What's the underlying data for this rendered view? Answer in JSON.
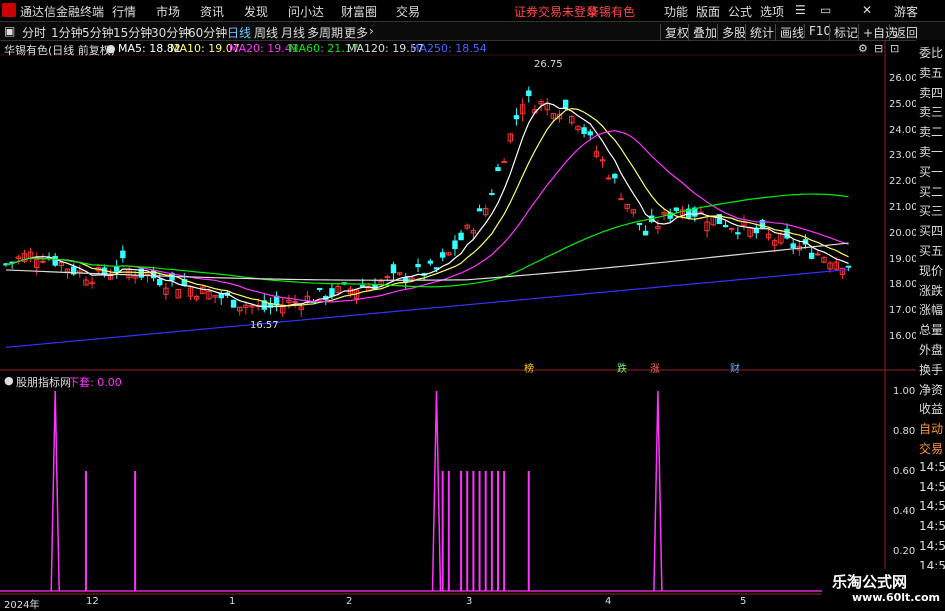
{
  "menubar": {
    "app_title": "通达信金融终端",
    "items": [
      "行情",
      "市场",
      "资讯",
      "发现",
      "问小达",
      "财富圈",
      "交易"
    ],
    "notice": "证券交易未登录",
    "stock_name": "华锡有色",
    "right_items": [
      "功能",
      "版面",
      "公式",
      "选项"
    ],
    "guest": "游客"
  },
  "toolbar": {
    "periods": [
      "分时",
      "1分钟",
      "5分钟",
      "15分钟",
      "30分钟",
      "60分钟",
      "日线",
      "周线",
      "月线",
      "多周期",
      "更多"
    ],
    "active_period": "日线",
    "right_buttons": [
      "复权",
      "叠加",
      "多股",
      "统计",
      "画线",
      "F10",
      "标记",
      "+自选",
      "返回"
    ]
  },
  "legend": {
    "stock": "华锡有色(日线 前复权)",
    "ma5": "MA5: 18.82",
    "ma10": "MA10: 19.07",
    "ma20": "MA20: 19.41",
    "ma60": "MA60: 21.17",
    "ma120": "MA120: 19.57",
    "ma250": "MA250: 18.54"
  },
  "colors": {
    "ma5": "#ffffff",
    "ma10": "#ffff66",
    "ma20": "#ff33ff",
    "ma60": "#00ee00",
    "ma120": "#dddddd",
    "ma250": "#3333ff",
    "up": "#ff3333",
    "down": "#33ffff",
    "indicator": "#ff33ff"
  },
  "price_axis": [
    "26.00",
    "25.00",
    "24.00",
    "23.00",
    "22.00",
    "21.00",
    "20.00",
    "19.00",
    "18.00",
    "17.00",
    "16.00"
  ],
  "annotations": {
    "high": "26.75",
    "low": "16.57",
    "markers": [
      {
        "label": "榜",
        "color": "#ffcc00"
      },
      {
        "label": "跌",
        "color": "#66ff66"
      },
      {
        "label": "涨",
        "color": "#ff6666"
      },
      {
        "label": "财",
        "color": "#66aaff"
      }
    ]
  },
  "indicator": {
    "name": "股朋指标网",
    "label": "下套: 0.00",
    "y_axis": [
      "1.00",
      "0.80",
      "0.60",
      "0.40",
      "0.20"
    ]
  },
  "right_panel": [
    "委比",
    "卖五",
    "卖四",
    "卖三",
    "卖二",
    "卖一",
    "买一",
    "买二",
    "买三",
    "买四",
    "买五",
    "现价",
    "涨跌",
    "涨幅",
    "总量",
    "外盘",
    "换手",
    "净资",
    "收益",
    "自动",
    "交易",
    "14:56",
    "14:56",
    "14:56",
    "14:56",
    "14:56",
    "14:56",
    "14:56"
  ],
  "x_axis": [
    "2024年",
    "12",
    "1",
    "2",
    "3",
    "4",
    "5"
  ],
  "watermark": {
    "title": "乐淘公式网",
    "url": "www.60lt.com"
  }
}
